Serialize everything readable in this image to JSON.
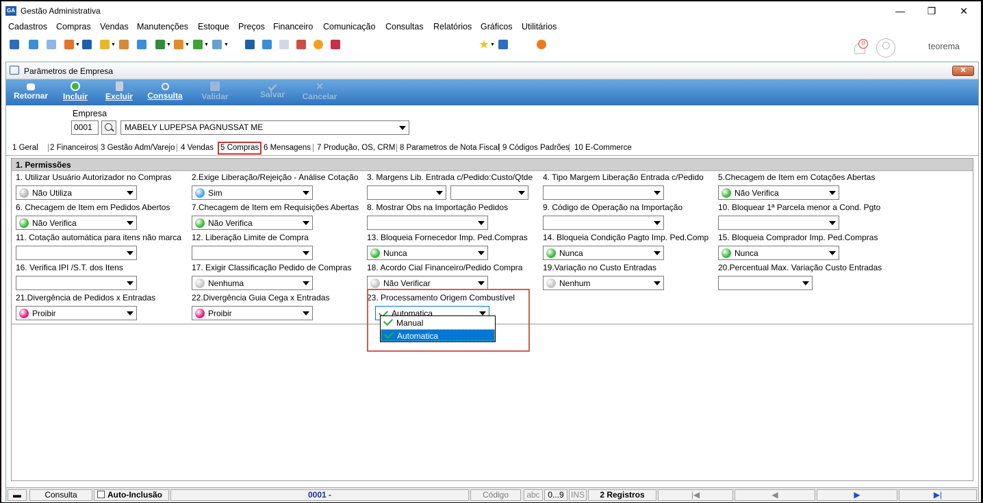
{
  "window": {
    "title": "Gestão Administrativa",
    "controls": {
      "minimize": "—",
      "restore": "❐",
      "close": "✕"
    }
  },
  "menu": [
    "Cadastros",
    "Compras",
    "Vendas",
    "Manutenções",
    "Estoque",
    "Preços",
    "Financeiro",
    "Comunicação",
    "Consultas",
    "Relatórios",
    "Gráficos",
    "Utilitários"
  ],
  "notification": {
    "count": "0"
  },
  "user": {
    "name": "teorema"
  },
  "form": {
    "title": "Parâmetros de Empresa",
    "close_label": "✕"
  },
  "actions": [
    {
      "label": "Retornar",
      "enabled": true,
      "icon": "return-icon"
    },
    {
      "label": "Incluir",
      "enabled": true,
      "icon": "add-icon"
    },
    {
      "label": "Excluir",
      "enabled": true,
      "icon": "trash-icon"
    },
    {
      "label": "Consulta",
      "enabled": true,
      "icon": "search-icon"
    },
    {
      "label": "Validar",
      "enabled": false,
      "icon": "validate-icon"
    },
    {
      "label": "Salvar",
      "enabled": false,
      "icon": "save-icon"
    },
    {
      "label": "Cancelar",
      "enabled": false,
      "icon": "cancel-icon"
    }
  ],
  "empresa": {
    "label": "Empresa",
    "code": "0001",
    "name": "MABELY LUPEPSA PAGNUSSAT ME"
  },
  "tabs": [
    "1 Geral",
    "2 Financeiros",
    "3 Gestão Adm/Varejo",
    "4 Vendas",
    "5 Compras",
    "6 Mensagens",
    "7 Produção, OS, CRM",
    "8 Parametros de Nota Fiscal",
    "9 Códigos Padrões",
    "10 E-Commerce"
  ],
  "active_tab": "5 Compras",
  "section": {
    "title": "1.  Permissões"
  },
  "fields": [
    {
      "label": "1. Utilizar Usuário Autorizador no Compras",
      "value": "Não Utiliza",
      "indicator": "#b5b5b5"
    },
    {
      "label": "2.Exige Liberação/Rejeição - Análise Cotação",
      "value": "Sim",
      "indicator": "#4aa3e8"
    },
    {
      "label": "3. Margens Lib. Entrada c/Pedido:Custo/Qtde",
      "value": "",
      "value2": "",
      "indicator": ""
    },
    {
      "label": "4. Tipo Margem Liberação Entrada c/Pedido",
      "value": "",
      "indicator": ""
    },
    {
      "label": "5.Checagem de Item em Cotações Abertas",
      "value": "Não Verifica",
      "indicator": "#3fb63a"
    },
    {
      "label": "6. Checagem de Item em Pedidos Abertos",
      "value": "Não Verifica",
      "indicator": "#3fb63a"
    },
    {
      "label": "7.Checagem de Item em Requisições Abertas",
      "value": "Não Verifica",
      "indicator": "#3fb63a"
    },
    {
      "label": "8. Mostrar Obs na Importação Pedidos",
      "value": "",
      "indicator": ""
    },
    {
      "label": "9. Código de Operação na Importação",
      "value": "",
      "indicator": ""
    },
    {
      "label": "10. Bloquear 1ª Parcela menor a Cond. Pgto",
      "value": "",
      "indicator": ""
    },
    {
      "label": "11. Cotação automática para itens não marca",
      "value": "",
      "indicator": ""
    },
    {
      "label": "12. Liberação Limite de Compra",
      "value": "",
      "indicator": ""
    },
    {
      "label": "13. Bloqueia Fornecedor Imp. Ped.Compras",
      "value": "Nunca",
      "indicator": "#3fb63a"
    },
    {
      "label": "14. Bloqueia Condição Pagto Imp. Ped.Comp",
      "value": "Nunca",
      "indicator": "#3fb63a"
    },
    {
      "label": "15. Bloqueia Comprador  Imp. Ped.Compras",
      "value": "Nunca",
      "indicator": "#3fb63a"
    },
    {
      "label": "16. Verifica IPI /S.T. dos Itens",
      "value": "",
      "indicator": ""
    },
    {
      "label": "17. Exigir Classificação Pedido de Compras",
      "value": "Nenhuma",
      "indicator": "#c4c4c4"
    },
    {
      "label": "18. Acordo Cial Financeiro/Pedido Compra",
      "value": "Não Verificar",
      "indicator": "#c4c4c4"
    },
    {
      "label": "19.Variação no Custo Entradas",
      "value": "Nenhum",
      "indicator": "#c4c4c4"
    },
    {
      "label": "20.Percentual Max. Variação Custo Entradas",
      "value": "",
      "indicator": ""
    },
    {
      "label": "21.Divergência de Pedidos x Entradas",
      "value": "Proibir",
      "indicator": "#e0207a"
    },
    {
      "label": "22.Divergência Guia Cega x Entradas",
      "value": "Proibir",
      "indicator": "#e0207a"
    },
    {
      "label": "23. Processamento Origem Combustível",
      "value": "Automatica",
      "indicator": "check"
    }
  ],
  "dropdown_options": [
    {
      "label": "Manual",
      "selected": false
    },
    {
      "label": "Automatica",
      "selected": true
    }
  ],
  "status": {
    "mode": "Consulta",
    "auto_label": "Auto-Inclusão",
    "record": "0001 -",
    "field": "Código",
    "abc": "abc",
    "num": "0...9",
    "ins": "INS",
    "count": "2 Registros",
    "first": "|◀",
    "prev": "◀",
    "next": "▶",
    "last": "▶|"
  }
}
